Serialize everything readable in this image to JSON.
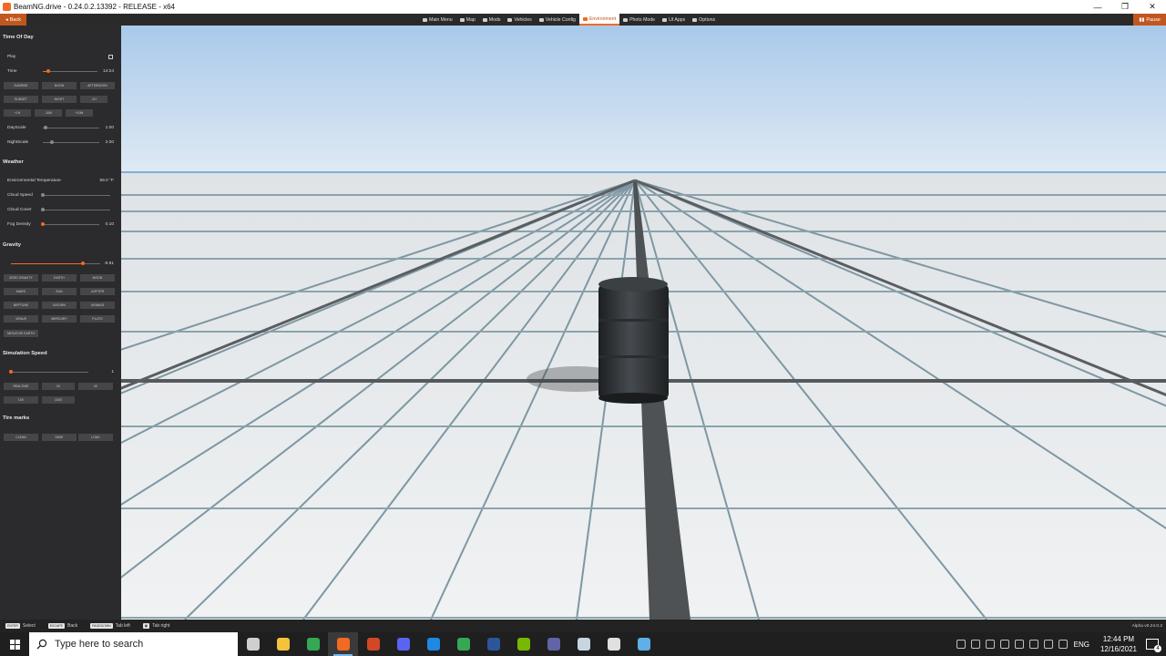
{
  "window": {
    "title": "BeamNG.drive - 0.24.0.2.13392 - RELEASE - x64",
    "minimize": "—",
    "restore": "❐",
    "close": "✕"
  },
  "menubar": {
    "back_label": "Back",
    "pause_label": "Pause",
    "items": [
      {
        "label": "Main Menu",
        "icon": "home-icon"
      },
      {
        "label": "Map",
        "icon": "map-icon"
      },
      {
        "label": "Mods",
        "icon": "mods-icon"
      },
      {
        "label": "Vehicles",
        "icon": "car-icon"
      },
      {
        "label": "Vehicle Config",
        "icon": "config-icon"
      },
      {
        "label": "Environment",
        "icon": "environment-icon",
        "active": true
      },
      {
        "label": "Photo Mode",
        "icon": "camera-icon"
      },
      {
        "label": "UI Apps",
        "icon": "apps-icon"
      },
      {
        "label": "Options",
        "icon": "options-icon"
      }
    ]
  },
  "panel": {
    "time_of_day": {
      "title": "Time Of Day",
      "play_label": "Play",
      "time_label": "Time",
      "time_value": "14:24",
      "time_fraction": 0.6,
      "buttons_row1": [
        "SUNRISE",
        "NOON",
        "AFTERNOON"
      ],
      "buttons_row2": [
        "SUNSET",
        "NIGHT",
        "-1H"
      ],
      "buttons_row3": [
        "+1H",
        "-10M",
        "+10M"
      ],
      "dayscale_label": "DayScale",
      "dayscale_value": "1.00",
      "nightscale_label": "NightScale",
      "nightscale_value": "2.00"
    },
    "weather": {
      "title": "Weather",
      "temp_label": "Environmental Temperature",
      "temp_value": "59.0 °F",
      "cloud_speed_label": "Cloud Speed",
      "cloud_cover_label": "Cloud Cover",
      "fog_label": "Fog Density",
      "fog_value": "0.10"
    },
    "gravity": {
      "title": "Gravity",
      "value": "-9.81",
      "buttons": [
        "ZERO GRAVITY",
        "EARTH",
        "MOON",
        "MARS",
        "SUN",
        "JUPITER",
        "NEPTUNE",
        "SATURN",
        "URANUS",
        "VENUS",
        "MERCURY",
        "PLUTO",
        "NEGATIVE EARTH"
      ]
    },
    "simulation": {
      "title": "Simulation Speed",
      "value": "1",
      "buttons_row1": [
        "REALTIME",
        "2X",
        "4X"
      ],
      "buttons_row2": [
        "10X",
        "100X"
      ]
    },
    "tire_marks": {
      "title": "Tire marks",
      "buttons": [
        "CLEAN",
        "SAVE",
        "LOAD"
      ]
    }
  },
  "hints": [
    {
      "key": "ENTER",
      "label": "Select"
    },
    {
      "key": "ESCAPE",
      "label": "Back"
    },
    {
      "key": "PAGEDOWN",
      "label": "Tab left"
    },
    {
      "key": "▣",
      "label": "Tab right"
    }
  ],
  "version": "Alpha v0.24.0.2",
  "taskbar": {
    "search_placeholder": "Type here to search",
    "language": "ENG",
    "time": "12:44 PM",
    "date": "12/16/2021",
    "notification_count": "4",
    "apps": [
      {
        "name": "task-view-icon",
        "color": "#cfcfcf"
      },
      {
        "name": "file-explorer-icon",
        "color": "#f3c33b"
      },
      {
        "name": "chrome-icon",
        "color": "#34a853"
      },
      {
        "name": "beamng-icon",
        "color": "#f26a21",
        "active": true
      },
      {
        "name": "powerpoint-icon",
        "color": "#d24726"
      },
      {
        "name": "discord-icon",
        "color": "#5865f2"
      },
      {
        "name": "media-player-icon",
        "color": "#1e88e5"
      },
      {
        "name": "chrome-profile-icon",
        "color": "#34a853"
      },
      {
        "name": "word-icon",
        "color": "#2b579a"
      },
      {
        "name": "nvidia-icon",
        "color": "#76b900"
      },
      {
        "name": "teams-icon",
        "color": "#6264a7"
      },
      {
        "name": "steam-icon",
        "color": "#c7d5e0"
      },
      {
        "name": "unity-icon",
        "color": "#e0e0e0"
      },
      {
        "name": "app-installer-icon",
        "color": "#5fb0e8"
      }
    ]
  }
}
